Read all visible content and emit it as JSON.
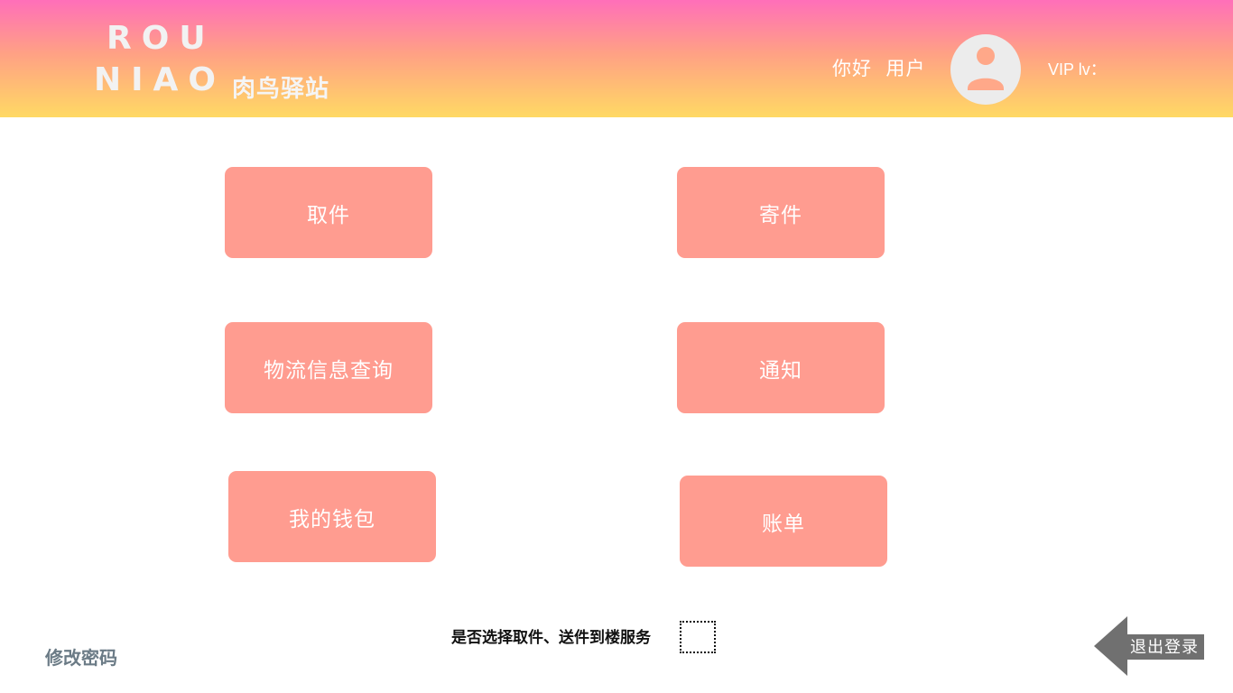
{
  "header": {
    "logo_line1": "ROU",
    "logo_line2": "NIAO",
    "logo_cn": "肉鸟驿站",
    "greeting": "你好  用户",
    "vip_label": "VIP lv：",
    "avatar_icon": "user-avatar-icon"
  },
  "menu": {
    "pickup": "取件",
    "send": "寄件",
    "tracking": "物流信息查询",
    "notification": "通知",
    "wallet": "我的钱包",
    "bill": "账单"
  },
  "footer": {
    "door_service_label": "是否选择取件、送件到楼服务",
    "change_password": "修改密码",
    "logout": "退出登录",
    "logout_icon": "arrow-left-icon"
  },
  "colors": {
    "header_top": "#ff6fb9",
    "header_bottom": "#ffd964",
    "button": "#ff9c90",
    "logout_arrow": "#707070"
  }
}
